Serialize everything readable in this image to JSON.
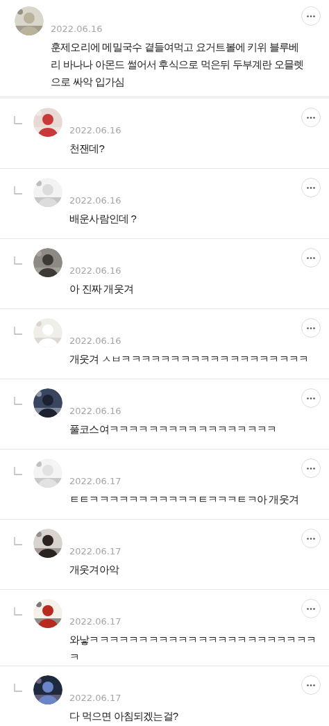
{
  "comments": [
    {
      "kind": "comment",
      "date": "2022.06.16",
      "text": "훈제오리에 메밀국수 곁들여먹고 요거트볼에 키위 블루베리 바나나 아몬드 썰어서 후식으로 먹은뒤 두부계란 오믈렛으로 싸악 입가심"
    },
    {
      "kind": "reply",
      "date": "2022.06.16",
      "text": "천잰데?"
    },
    {
      "kind": "reply",
      "date": "2022.06.16",
      "text": "배운사람인데 ?"
    },
    {
      "kind": "reply",
      "date": "2022.06.16",
      "text": "아 진짜 개웃겨"
    },
    {
      "kind": "reply",
      "date": "2022.06.16",
      "text": "개웃겨 ㅅㅂㅋㅋㅋㅋㅋㅋㅋㅋㅋㅋㅋㅋㅋㅋㅋㅋㅋㅋㅋ"
    },
    {
      "kind": "reply",
      "date": "2022.06.16",
      "text": "풀코스여ㅋㅋㅋㅋㅋㅋㅋㅋㅋㅋㅋㅋㅋㅋㅋㅋㅋ"
    },
    {
      "kind": "reply",
      "date": "2022.06.17",
      "text": "ㅌㅌㅋㅋㅋㅋㅋㅋㅋㅋㅋㅋㅋㅌㅋㅋㅋㅌㅋ아 개웃겨"
    },
    {
      "kind": "reply",
      "date": "2022.06.17",
      "text": "개웃겨아악"
    },
    {
      "kind": "reply",
      "date": "2022.06.17",
      "text": "와낳ㅋㅋㅋㅋㅋㅋㅋㅋㅋㅋㅋㅋㅋㅋㅋㅋㅋㅋㅋㅋㅋㅋㅋㅋ"
    },
    {
      "kind": "reply",
      "date": "2022.06.17",
      "text": "다 먹으면 아침되겠는걸?"
    }
  ]
}
